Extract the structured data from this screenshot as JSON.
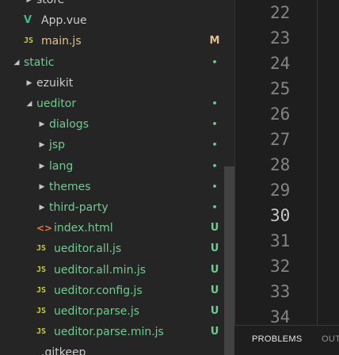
{
  "explorer": {
    "items": [
      {
        "label": "store",
        "twisty": "collapsed",
        "icon": "chevron-right-icon",
        "badge": ""
      },
      {
        "label": "App.vue",
        "twisty": "",
        "icon": "vue-file-icon",
        "icon_glyph": "V",
        "badge": ""
      },
      {
        "label": "main.js",
        "twisty": "",
        "icon": "js-file-icon",
        "icon_glyph": "JS",
        "badge": "M"
      },
      {
        "label": "static",
        "twisty": "expanded",
        "icon": "chevron-down-icon",
        "badge": "•"
      },
      {
        "label": "ezuikit",
        "twisty": "collapsed",
        "icon": "chevron-right-icon",
        "badge": ""
      },
      {
        "label": "ueditor",
        "twisty": "expanded",
        "icon": "chevron-down-icon",
        "badge": "•"
      },
      {
        "label": "dialogs",
        "twisty": "collapsed",
        "icon": "chevron-right-icon",
        "badge": "•"
      },
      {
        "label": "jsp",
        "twisty": "collapsed",
        "icon": "chevron-right-icon",
        "badge": "•"
      },
      {
        "label": "lang",
        "twisty": "collapsed",
        "icon": "chevron-right-icon",
        "badge": "•"
      },
      {
        "label": "themes",
        "twisty": "collapsed",
        "icon": "chevron-right-icon",
        "badge": "•"
      },
      {
        "label": "third-party",
        "twisty": "collapsed",
        "icon": "chevron-right-icon",
        "badge": "•"
      },
      {
        "label": "index.html",
        "twisty": "",
        "icon": "html-file-icon",
        "icon_glyph": "<>",
        "badge": "U"
      },
      {
        "label": "ueditor.all.js",
        "twisty": "",
        "icon": "js-file-icon",
        "icon_glyph": "JS",
        "badge": "U"
      },
      {
        "label": "ueditor.all.min.js",
        "twisty": "",
        "icon": "js-file-icon",
        "icon_glyph": "JS",
        "badge": "U"
      },
      {
        "label": "ueditor.config.js",
        "twisty": "",
        "icon": "js-file-icon",
        "icon_glyph": "JS",
        "badge": "U"
      },
      {
        "label": "ueditor.parse.js",
        "twisty": "",
        "icon": "js-file-icon",
        "icon_glyph": "JS",
        "badge": "U"
      },
      {
        "label": "ueditor.parse.min.js",
        "twisty": "",
        "icon": "js-file-icon",
        "icon_glyph": "JS",
        "badge": "U"
      },
      {
        "label": ".gitkeep",
        "twisty": "",
        "icon": "file-icon",
        "icon_glyph": "",
        "badge": ""
      }
    ]
  },
  "editor": {
    "line_numbers": [
      "22",
      "23",
      "24",
      "25",
      "26",
      "27",
      "28",
      "29",
      "30",
      "31",
      "32",
      "33",
      "34"
    ],
    "active_line": "30"
  },
  "panel": {
    "tabs": [
      "PROBLEMS",
      "OUTPUT"
    ]
  },
  "colors": {
    "sidebar_bg": "#252526",
    "editor_bg": "#1e1e1e",
    "modified": "#e2c08d",
    "untracked": "#73c991",
    "js_icon": "#cbcb41",
    "vue_icon": "#41b883",
    "html_icon": "#e37933"
  }
}
